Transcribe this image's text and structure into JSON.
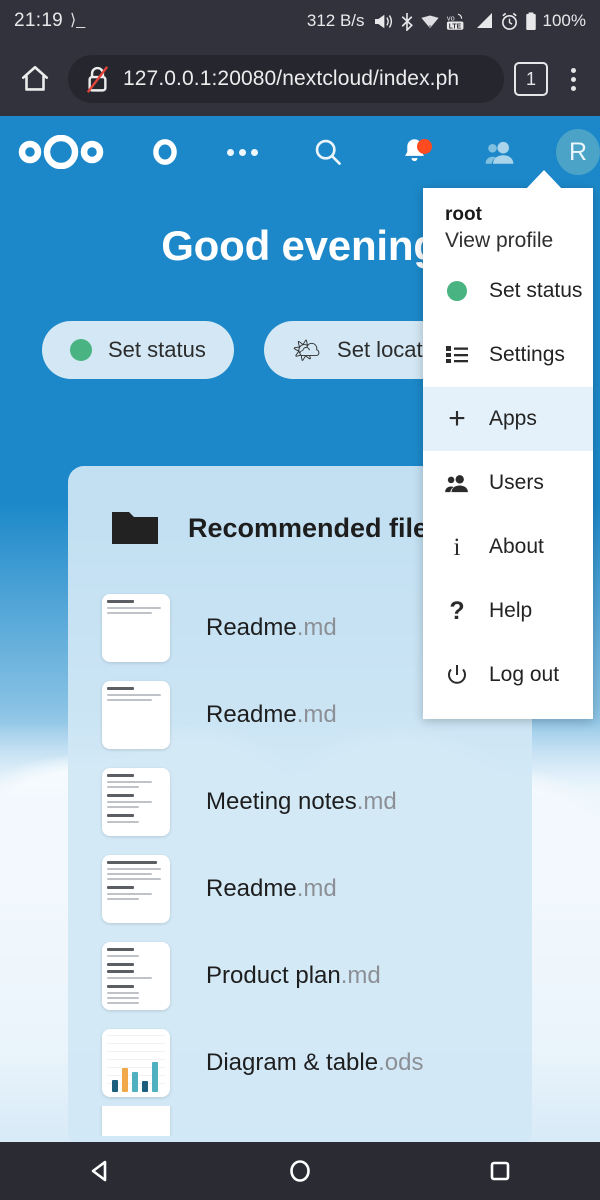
{
  "status_bar": {
    "clock": "21:19",
    "terminal_icon": "terminal-icon",
    "network_speed": "312 B/s",
    "icons": [
      "megaphone-icon",
      "bluetooth-icon",
      "wifi-icon",
      "volte-lte-icon",
      "cell-signal-icon",
      "alarm-icon",
      "battery-icon"
    ],
    "battery": "100%"
  },
  "browser": {
    "home_icon": "home-icon",
    "security_icon": "insecure-lock-icon",
    "url": "127.0.0.1:20080/nextcloud/index.ph",
    "url_full_visible": "127.0.0.1:20080/nextcloud/index.ph",
    "url_host": "127.0.0.1:20080",
    "url_path": "/nextcloud/index.ph",
    "tab_count": "1",
    "menu_icon": "kebab-menu-icon"
  },
  "nextcloud_header": {
    "logo": "nextcloud-logo",
    "dashboard_icon": "dashboard-circle-icon",
    "more_apps_icon": "more-dots-icon",
    "search_icon": "search-icon",
    "notifications_icon": "bell-icon",
    "notifications_badge": "",
    "contacts_icon": "contacts-icon",
    "avatar_initial": "R"
  },
  "dashboard": {
    "greeting": "Good evening",
    "chips": [
      {
        "label": "Set status",
        "icon": "status-dot-icon"
      },
      {
        "label": "Set location",
        "icon": "weather-sun-cloud-icon"
      }
    ],
    "card": {
      "icon": "folder-icon",
      "title": "Recommended files",
      "files": [
        {
          "name": "Readme",
          "ext": ".md",
          "thumb": "document-thumb"
        },
        {
          "name": "Readme",
          "ext": ".md",
          "thumb": "document-thumb"
        },
        {
          "name": "Meeting notes",
          "ext": ".md",
          "thumb": "document-thumb"
        },
        {
          "name": "Readme",
          "ext": ".md",
          "thumb": "document-thumb"
        },
        {
          "name": "Product plan",
          "ext": ".md",
          "thumb": "document-thumb"
        },
        {
          "name": "Diagram & table",
          "ext": ".ods",
          "thumb": "spreadsheet-chart-thumb"
        }
      ]
    }
  },
  "user_menu": {
    "name": "root",
    "view_profile": "View profile",
    "items": [
      {
        "label": "Set status",
        "icon": "status-dot-icon",
        "active": false
      },
      {
        "label": "Settings",
        "icon": "settings-list-icon",
        "active": false
      },
      {
        "label": "Apps",
        "icon": "plus-icon",
        "active": true
      },
      {
        "label": "Users",
        "icon": "users-icon",
        "active": false
      },
      {
        "label": "About",
        "icon": "info-icon",
        "active": false
      },
      {
        "label": "Help",
        "icon": "question-mark-icon",
        "active": false
      },
      {
        "label": "Log out",
        "icon": "power-icon",
        "active": false
      }
    ]
  },
  "nav_bar": {
    "back_icon": "triangle-back-icon",
    "home_icon": "circle-home-icon",
    "recents_icon": "square-recents-icon"
  },
  "colors": {
    "nextcloud_blue": "#1c88c9",
    "system_dark": "#2b2b33",
    "accent_green": "#49b382",
    "badge_red": "#ff4b1f",
    "menu_active": "#e5f1fa"
  }
}
